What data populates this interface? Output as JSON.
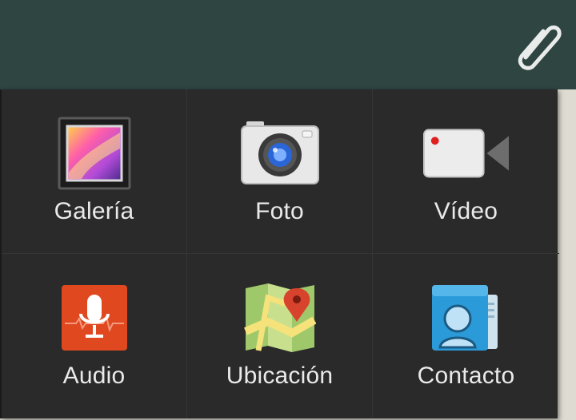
{
  "colors": {
    "top_bar": "#2e4542",
    "panel": "#2a2a2a",
    "label_text": "#eaeaea"
  },
  "topbar": {
    "attach_icon": "paperclip-icon"
  },
  "attach_menu": {
    "items": [
      {
        "label": "Galería",
        "icon": "gallery-icon"
      },
      {
        "label": "Foto",
        "icon": "camera-icon"
      },
      {
        "label": "Vídeo",
        "icon": "video-camera-icon"
      },
      {
        "label": "Audio",
        "icon": "microphone-icon"
      },
      {
        "label": "Ubicación",
        "icon": "map-pin-icon"
      },
      {
        "label": "Contacto",
        "icon": "contact-card-icon"
      }
    ]
  }
}
